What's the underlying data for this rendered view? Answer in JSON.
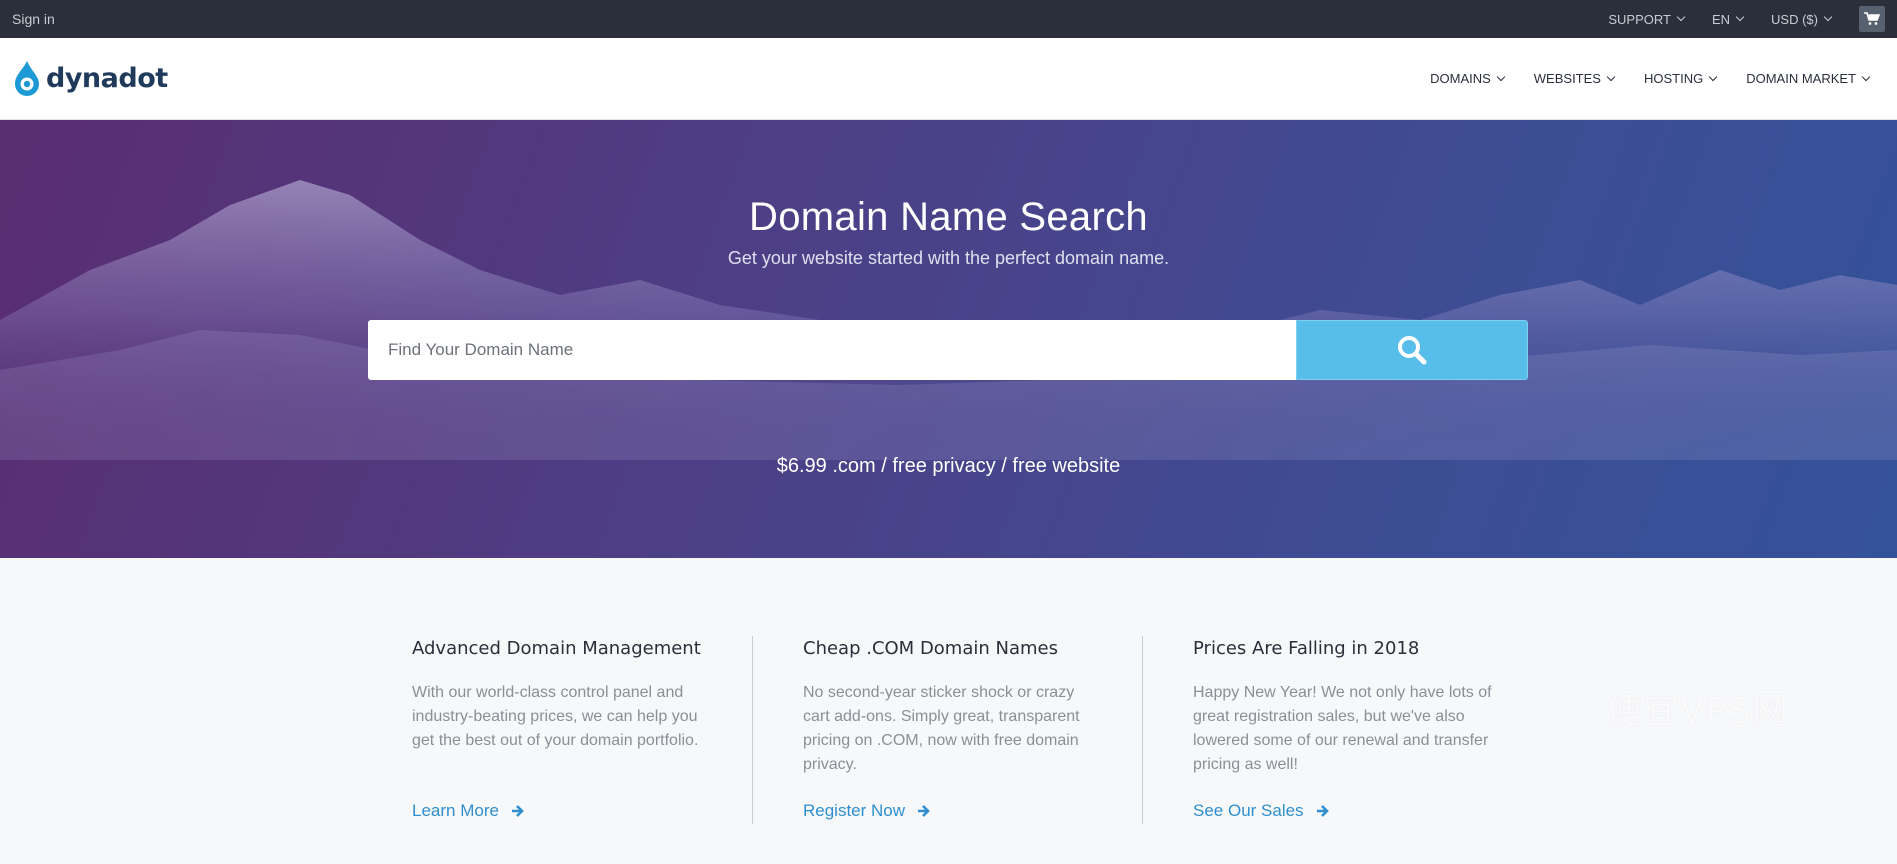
{
  "topbar": {
    "signin": "Sign in",
    "support": "SUPPORT",
    "language": "EN",
    "currency": "USD ($)",
    "cart_icon": "cart-icon"
  },
  "nav": {
    "logo_text": "dynadot",
    "logo_icon": "dynadot-logo-icon",
    "items": [
      "DOMAINS",
      "WEBSITES",
      "HOSTING",
      "DOMAIN MARKET"
    ]
  },
  "hero": {
    "title": "Domain Name Search",
    "subtitle": "Get your website started with the perfect domain name.",
    "search_placeholder": "Find Your Domain Name",
    "search_icon": "search-icon",
    "promo": "$6.99 .com / free privacy / free website"
  },
  "features": [
    {
      "title": "Advanced Domain Management",
      "text": "With our world-class control panel and industry-beating prices, we can help you get the best out of your domain portfolio.",
      "link": "Learn More"
    },
    {
      "title": "Cheap .COM Domain Names",
      "text": "No second-year sticker shock or crazy cart add-ons. Simply great, transparent pricing on .COM, now with free domain privacy.",
      "link": "Register Now"
    },
    {
      "title": "Prices Are Falling in 2018",
      "text": "Happy New Year! We not only have lots of great registration sales, but we've also lowered some of our renewal and transfer pricing as well!",
      "link": "See Our Sales"
    }
  ],
  "watermark": "便宜VPS网",
  "colors": {
    "topbar": "#2a2f3a",
    "search_button": "#57bde9",
    "link": "#2f8fce",
    "logo_blue": "#1d9ad6"
  }
}
